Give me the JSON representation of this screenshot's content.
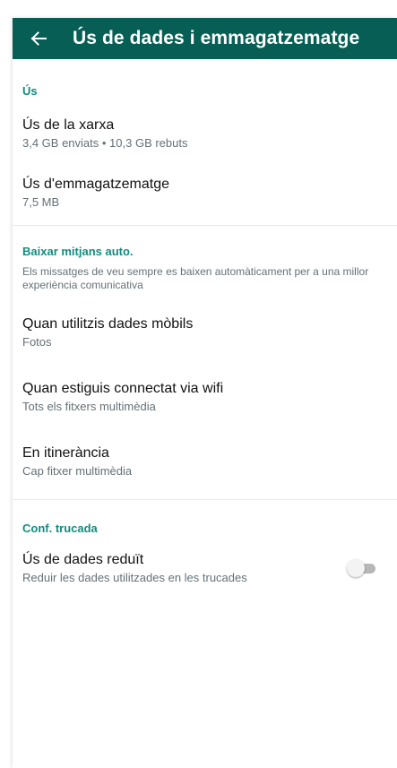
{
  "app_bar": {
    "back_icon": "arrow-left-icon",
    "title": "Ús de dades i emmagatzematge",
    "color": "#075e54"
  },
  "accent_color": "#128c7e",
  "sections": {
    "usage": {
      "header": "Ús",
      "network": {
        "title": "Ús de la xarxa",
        "subtitle": "3,4 GB enviats • 10,3 GB rebuts"
      },
      "storage": {
        "title": "Ús d'emmagatzematge",
        "subtitle": "7,5 MB"
      }
    },
    "auto_download": {
      "header": "Baixar mitjans auto.",
      "note": "Els missatges de veu sempre es baixen automàticament per a una millor experiència comunicativa",
      "mobile": {
        "title": "Quan utilitzis dades mòbils",
        "subtitle": "Fotos"
      },
      "wifi": {
        "title": "Quan estiguis connectat via wifi",
        "subtitle": "Tots els fitxers multimèdia"
      },
      "roaming": {
        "title": "En itinerància",
        "subtitle": "Cap fitxer multimèdia"
      }
    },
    "call_settings": {
      "header": "Conf. trucada",
      "low_data": {
        "title": "Ús de dades reduït",
        "subtitle": "Reduir les dades utilitzades en les trucades",
        "enabled": false
      }
    }
  }
}
